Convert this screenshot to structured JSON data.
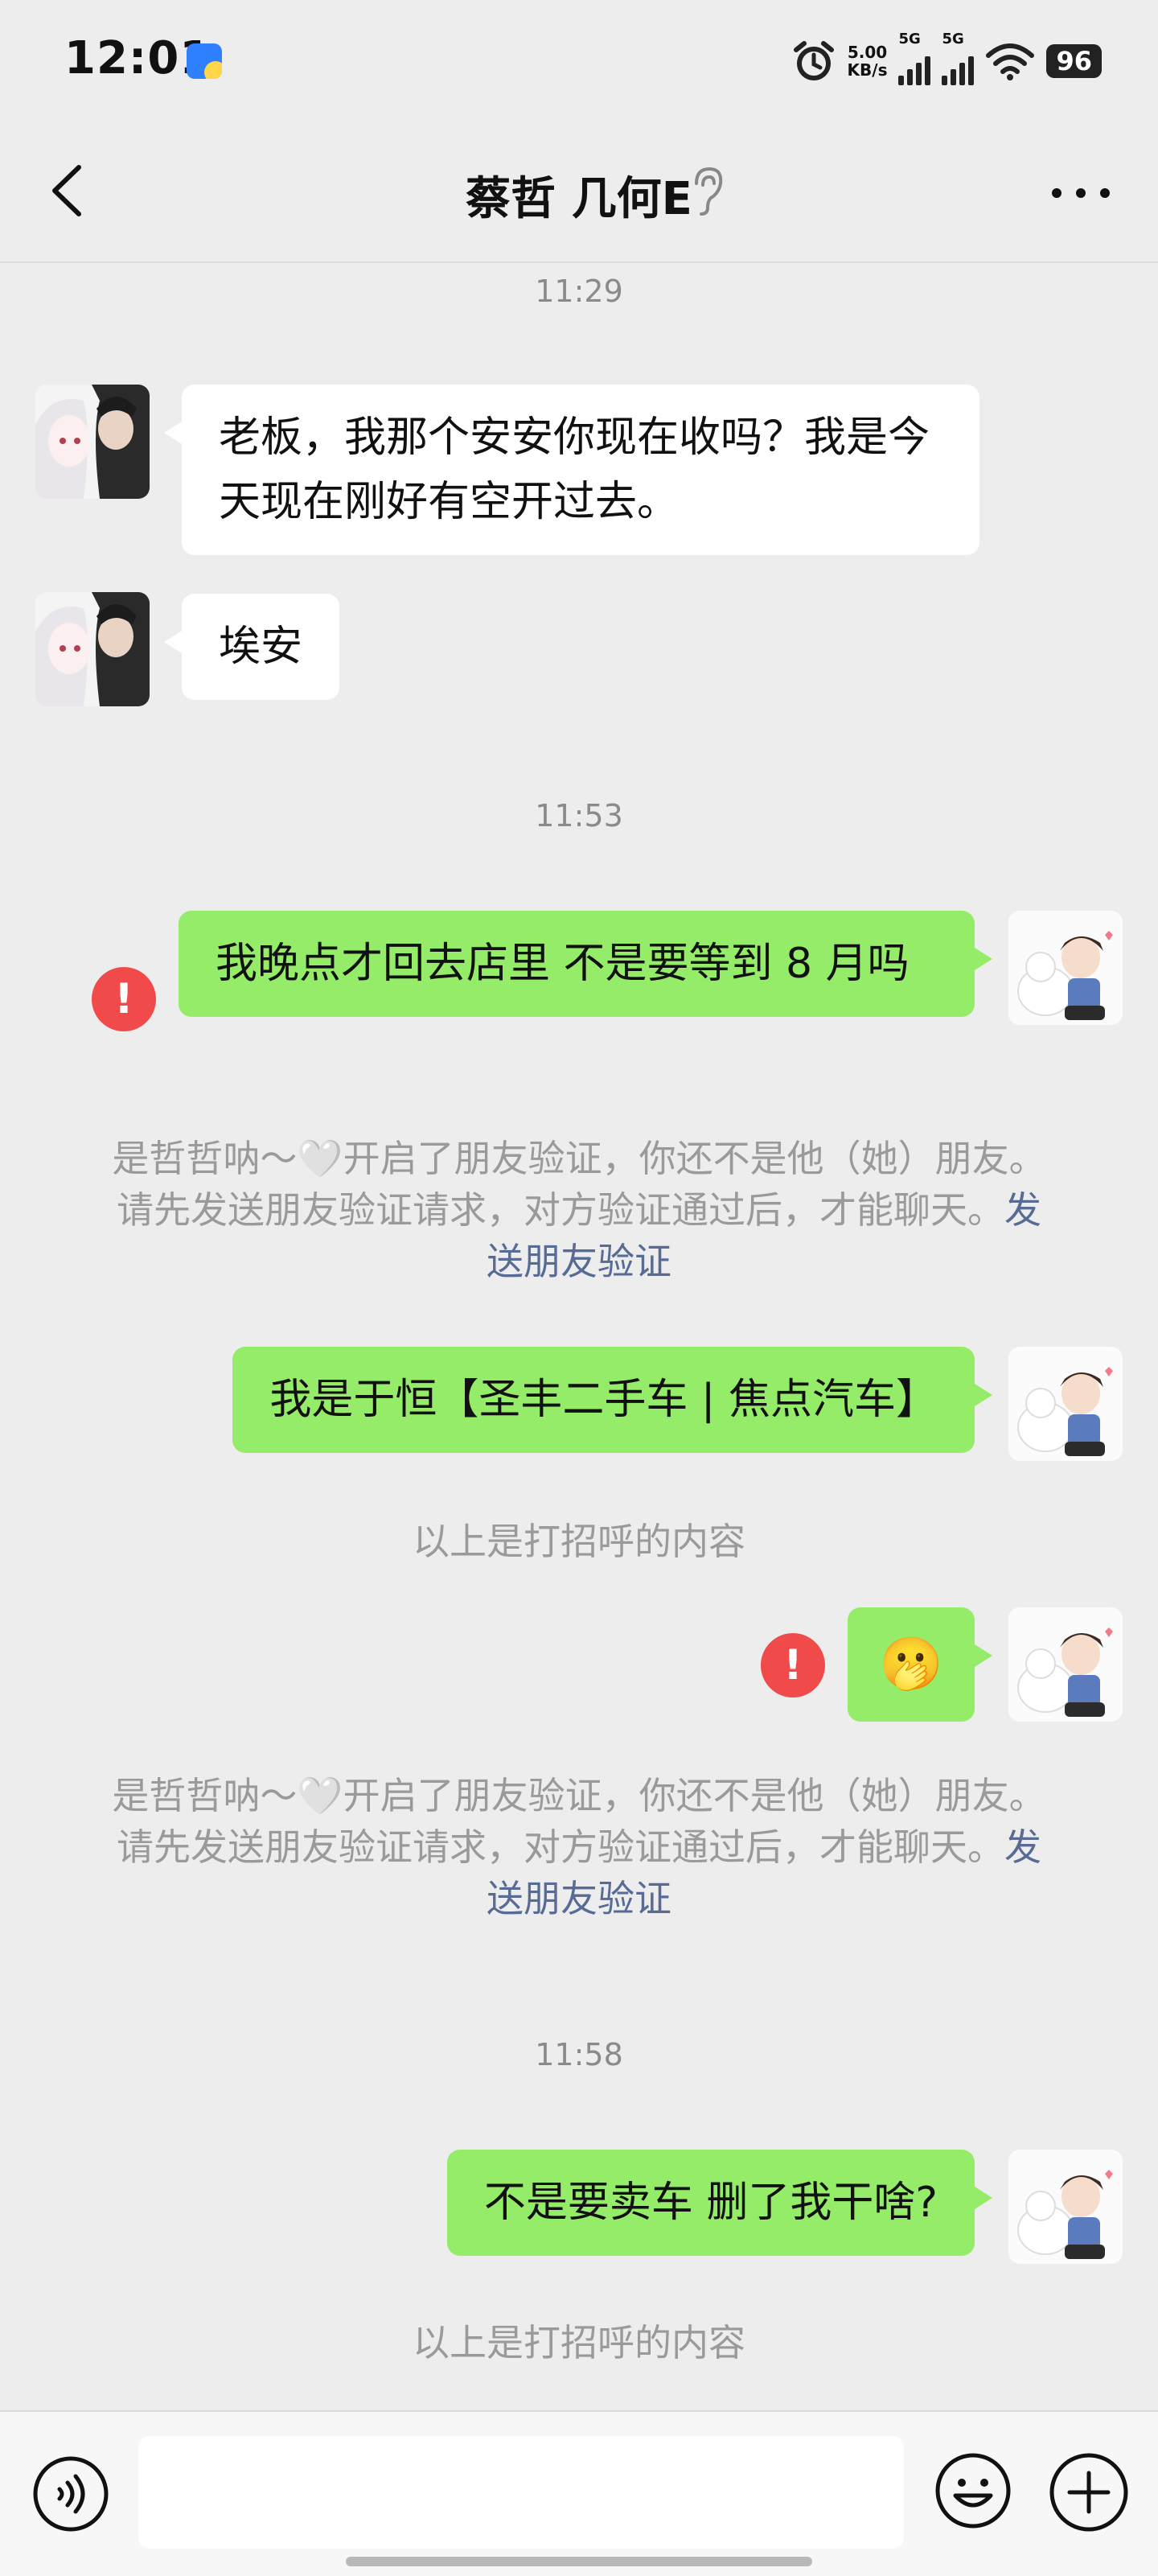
{
  "status": {
    "time": "12:01",
    "net_speed_value": "5.00",
    "net_speed_unit": "KB/s",
    "sim1": "5G",
    "sim2": "5G",
    "battery": "96"
  },
  "header": {
    "title": "蔡哲 几何E",
    "icons": [
      "back-icon",
      "ear-icon",
      "more-icon"
    ]
  },
  "messages": {
    "time1": "11:29",
    "in1": "老板，我那个安安你现在收吗？我是今天现在刚好有空开过去。",
    "in2": "埃安",
    "time2": "11:53",
    "out1": "我晚点才回去店里 不是要等到 8 月吗",
    "sys1_text": "是哲哲呐～🤍开启了朋友验证，你还不是他（她）朋友。请先发送朋友验证请求，对方验证通过后，才能聊天。",
    "sys1_link": "发送朋友验证",
    "out2": "我是于恒【圣丰二手车 | 焦点汽车】",
    "hint1": "以上是打招呼的内容",
    "out3_emoji": "🫢",
    "sys2_text": "是哲哲呐～🤍开启了朋友验证，你还不是他（她）朋友。请先发送朋友验证请求，对方验证通过后，才能聊天。",
    "sys2_link": "发送朋友验证",
    "time3": "11:58",
    "out4": "不是要卖车 删了我干啥?",
    "hint2": "以上是打招呼的内容"
  },
  "input": {
    "value": "",
    "icons": [
      "voice-icon",
      "emoji-icon",
      "plus-icon"
    ]
  },
  "colors": {
    "background": "#ededed",
    "bubble_out": "#95ec69",
    "bubble_in": "#ffffff",
    "link": "#576b95",
    "error": "#f04a4a"
  }
}
